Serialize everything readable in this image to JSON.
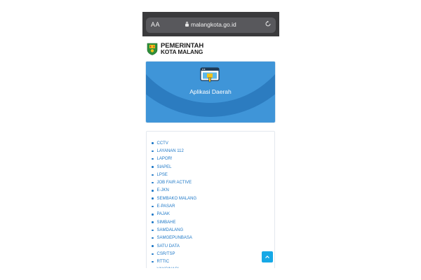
{
  "browser": {
    "text_size_label": "AA",
    "url": "malangkota.go.id"
  },
  "header": {
    "logo_line1": "PEMERINTAH",
    "logo_line2": "KOTA MALANG"
  },
  "app_card": {
    "title": "Aplikasi Daerah"
  },
  "links": [
    "CCTV",
    "LAYANAN 112",
    "LAPOR!",
    "SIAPEL",
    "LPSE",
    "JOB FAIR ACTIVE",
    "E-JKN",
    "SEMBAKO MALANG",
    "E-PASAR",
    "PAJAK",
    "SIMBAHE",
    "SAMDALANG",
    "SAMGEPUNBASA",
    "SATU DATA",
    "CSR/TSP",
    "RTTIC",
    "VAKSINASI"
  ],
  "colors": {
    "primary_blue": "#3f95d8",
    "link_blue": "#1e78c7",
    "scroll_button": "#16a8e6"
  }
}
